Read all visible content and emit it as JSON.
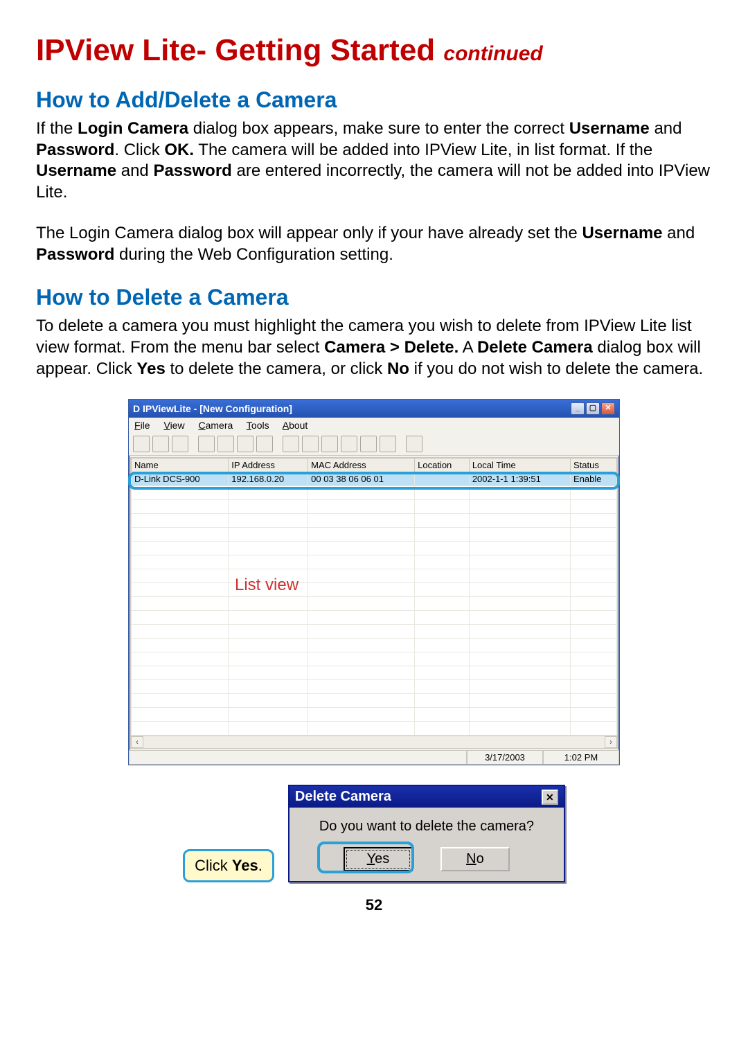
{
  "page": {
    "title_main": "IPView Lite- Getting Started ",
    "title_cont": "continued",
    "number": "52"
  },
  "section1": {
    "heading": "How to Add/Delete a Camera",
    "p1_a": "If the ",
    "p1_b1": "Login Camera",
    "p1_c": " dialog box appears,  make sure to enter the correct ",
    "p1_b2": "Username",
    "p1_d": " and ",
    "p1_b3": "Password",
    "p1_e": ". Click ",
    "p1_b4": "OK.",
    "p1_f": " The camera will be added into IPView Lite, in list format.  If the ",
    "p1_b5": "Username",
    "p1_g": " and ",
    "p1_b6": "Password",
    "p1_h": " are entered incorrectly,  the camera will not be added into IPView Lite.",
    "p2_a": "The Login Camera dialog box will appear only if your have already set the ",
    "p2_b1": "Username",
    "p2_b": " and ",
    "p2_b2": "Password",
    "p2_c": " during the Web Configuration setting."
  },
  "section2": {
    "heading": "How to Delete a Camera",
    "p1_a": "To delete a camera you must highlight the camera you wish to delete from IPView Lite list view format. From the menu bar select ",
    "p1_b1": "Camera > Delete.",
    "p1_b": "  A ",
    "p1_b2": "Delete Camera",
    "p1_c": " dialog box will appear.  Click ",
    "p1_b3": "Yes",
    "p1_d": " to delete the camera, or click  ",
    "p1_b4": "No",
    "p1_e": " if you do not wish to delete the camera."
  },
  "ipv": {
    "title": "D  IPViewLite - [New Configuration]",
    "menus": [
      "File",
      "View",
      "Camera",
      "Tools",
      "About"
    ],
    "columns": [
      "Name",
      "IP Address",
      "MAC Address",
      "Location",
      "Local Time",
      "Status"
    ],
    "row": {
      "name": "D-Link DCS-900",
      "ip": "192.168.0.20",
      "mac": "00 03 38 06 06 01",
      "location": "",
      "localtime": "2002-1-1  1:39:51",
      "status": "Enable"
    },
    "status_date": "3/17/2003",
    "status_time": "1:02 PM",
    "list_view_label": "List view"
  },
  "dialog": {
    "title": "Delete Camera",
    "message": "Do you want to delete the camera?",
    "yes": "Yes",
    "no": "No"
  },
  "callout": {
    "click": "Click ",
    "yes": "Yes",
    "dot": "."
  }
}
